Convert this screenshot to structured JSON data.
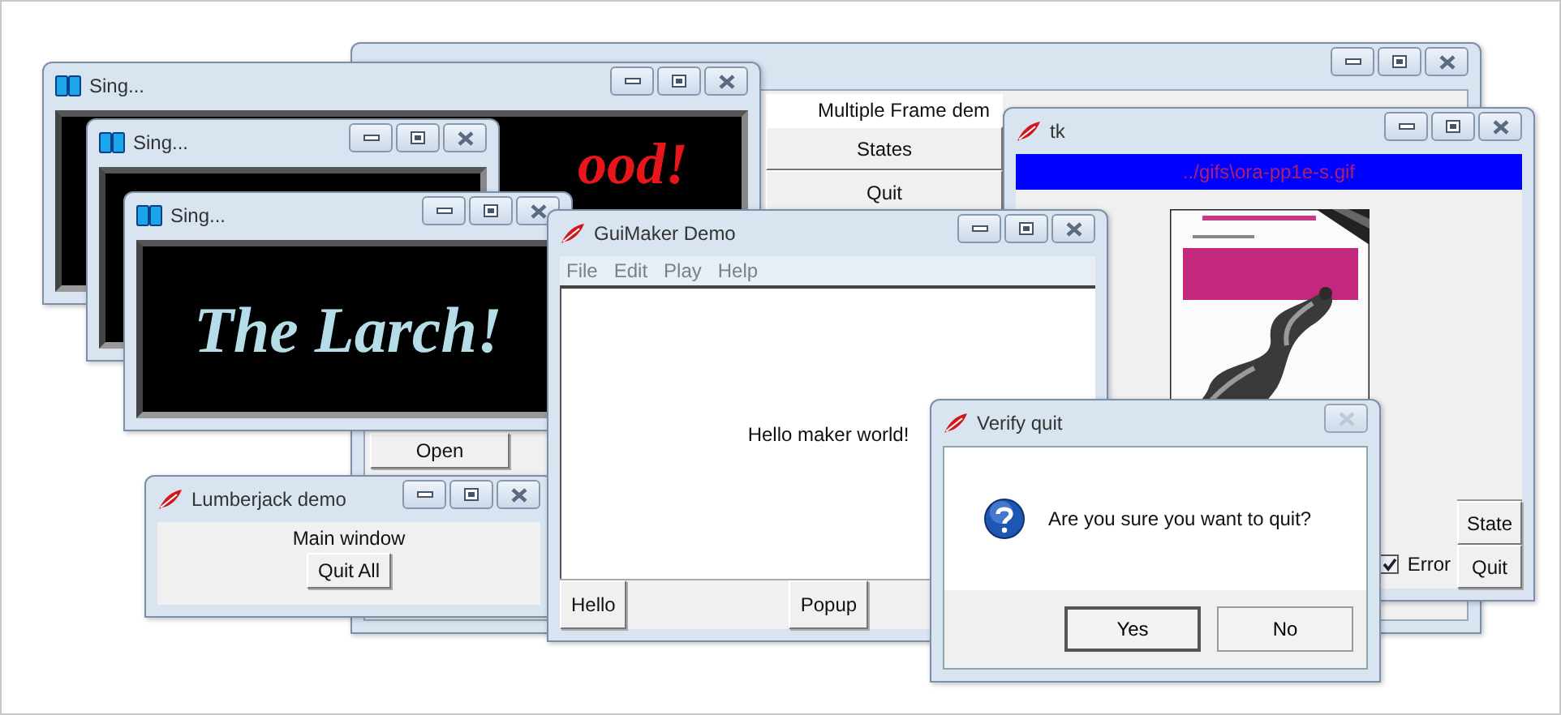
{
  "frame_demo": {
    "label": "Multiple Frame dem",
    "buttons": [
      "States",
      "Quit"
    ],
    "open_button": "Open"
  },
  "tk_viewer": {
    "title": "tk",
    "path": "../gifs\\ora-pp1e-s.gif",
    "buttons": [
      "State",
      "Quit"
    ],
    "error_check": {
      "label": "Error",
      "checked": true
    }
  },
  "sing_windows": [
    {
      "title": "Sing...",
      "message": "ood!",
      "color": "#e8161b"
    },
    {
      "title": "Sing..."
    },
    {
      "title": "Sing...",
      "message": "The Larch!",
      "color": "#b4dde8"
    }
  ],
  "lumberjack": {
    "title": "Lumberjack demo",
    "label": "Main window",
    "button": "Quit All"
  },
  "guimaker": {
    "title": "GuiMaker Demo",
    "menu": [
      "File",
      "Edit",
      "Play",
      "Help"
    ],
    "message": "Hello maker world!",
    "buttons": [
      "Hello",
      "Popup"
    ]
  },
  "verify_quit": {
    "title": "Verify quit",
    "message": "Are you sure you want to quit?",
    "buttons": [
      {
        "label": "Yes",
        "focused": true
      },
      {
        "label": "No",
        "focused": false
      }
    ]
  }
}
